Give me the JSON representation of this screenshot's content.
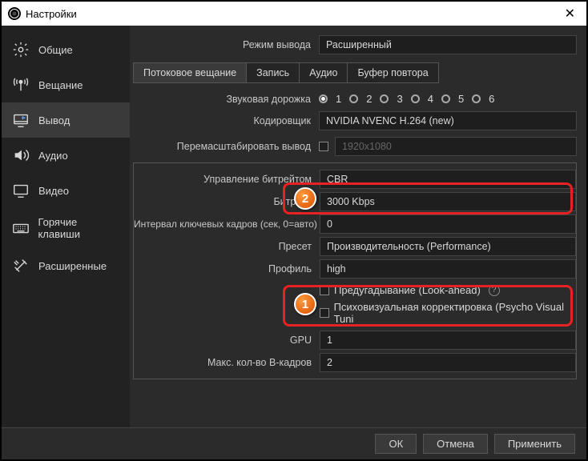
{
  "window": {
    "title": "Настройки"
  },
  "sidebar": {
    "items": [
      {
        "label": "Общие"
      },
      {
        "label": "Вещание"
      },
      {
        "label": "Вывод"
      },
      {
        "label": "Аудио"
      },
      {
        "label": "Видео"
      },
      {
        "label": "Горячие клавиши"
      },
      {
        "label": "Расширенные"
      }
    ]
  },
  "top": {
    "output_mode_label": "Режим вывода",
    "output_mode_value": "Расширенный"
  },
  "tabs": {
    "streaming": "Потоковое вещание",
    "recording": "Запись",
    "audio": "Аудио",
    "replay": "Буфер повтора"
  },
  "fields": {
    "audio_track_label": "Звуковая дорожка",
    "encoder_label": "Кодировщик",
    "encoder_value": "NVIDIA NVENC H.264 (new)",
    "rescale_label": "Перемасштабировать вывод",
    "rescale_value": "1920x1080",
    "rate_control_label": "Управление битрейтом",
    "rate_control_value": "CBR",
    "bitrate_label": "Битрейт",
    "bitrate_value": "3000 Kbps",
    "keyint_label": "Интервал ключевых кадров (сек, 0=авто)",
    "keyint_value": "0",
    "preset_label": "Пресет",
    "preset_value": "Производительность (Performance)",
    "profile_label": "Профиль",
    "profile_value": "high",
    "lookahead_label": "Предугадывание (Look-ahead)",
    "psycho_label": "Психовизуальная корректировка (Psycho Visual Tuni",
    "gpu_label": "GPU",
    "gpu_value": "1",
    "bframes_label": "Макс. кол-во B-кадров",
    "bframes_value": "2"
  },
  "tracks": [
    "1",
    "2",
    "3",
    "4",
    "5",
    "6"
  ],
  "footer": {
    "ok": "ОК",
    "cancel": "Отмена",
    "apply": "Применить"
  },
  "callouts": {
    "one": "1",
    "two": "2"
  }
}
